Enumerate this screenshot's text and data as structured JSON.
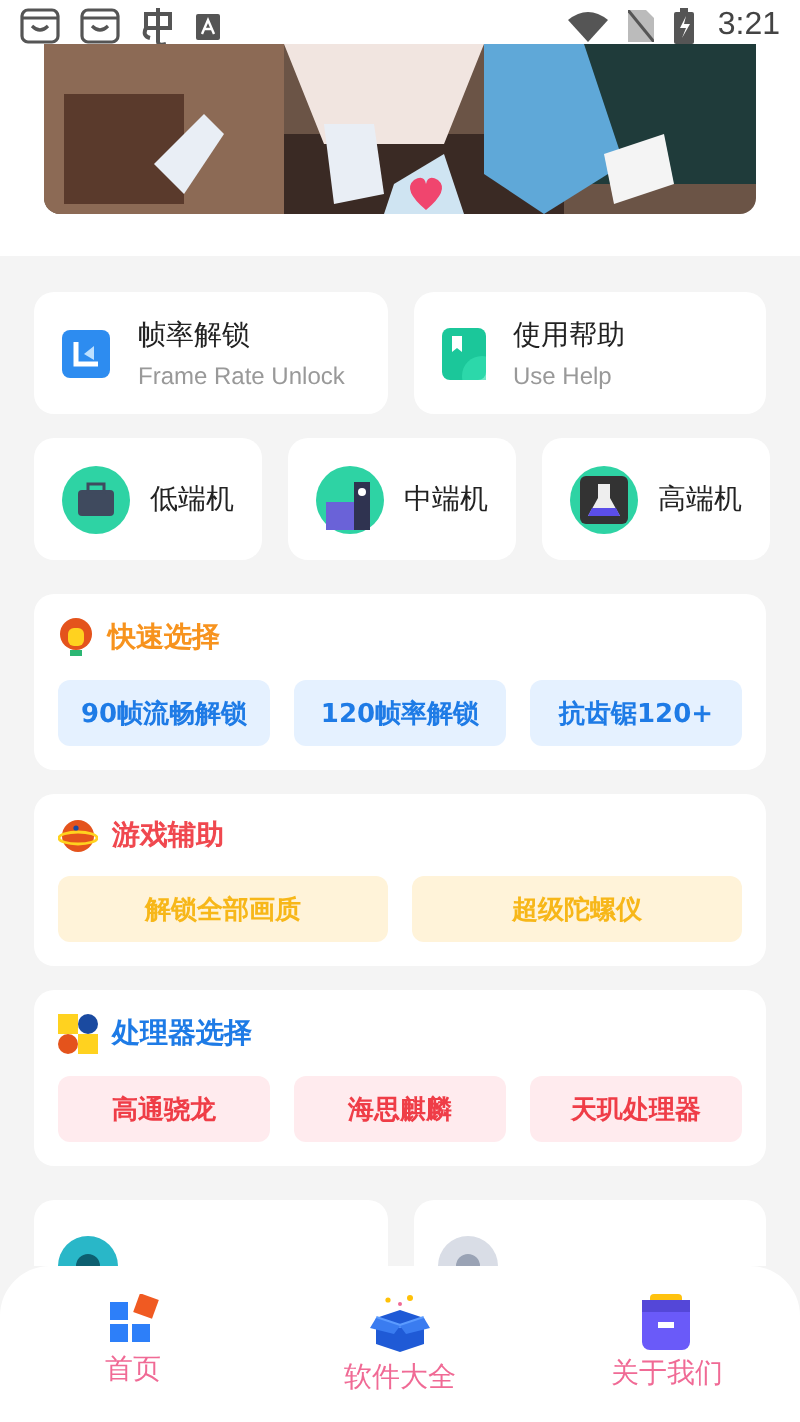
{
  "status_bar": {
    "time": "3:21"
  },
  "feature_cards": [
    {
      "title": "帧率解锁",
      "subtitle": "Frame Rate Unlock",
      "kind": "frame"
    },
    {
      "title": "使用帮助",
      "subtitle": "Use Help",
      "kind": "help"
    }
  ],
  "tiers": [
    {
      "label": "低端机",
      "kind": "low"
    },
    {
      "label": "中端机",
      "kind": "mid"
    },
    {
      "label": "高端机",
      "kind": "high"
    }
  ],
  "sections": [
    {
      "title": "快速选择",
      "kind": "quick",
      "options": [
        "90帧流畅解锁",
        "120帧率解锁",
        "抗齿锯120+"
      ]
    },
    {
      "title": "游戏辅助",
      "kind": "game",
      "options": [
        "解锁全部画质",
        "超级陀螺仪"
      ]
    },
    {
      "title": "处理器选择",
      "kind": "cpu",
      "options": [
        "高通骁龙",
        "海思麒麟",
        "天玑处理器"
      ]
    }
  ],
  "more_cards": [
    {
      "kind": "teal"
    },
    {
      "kind": "grey"
    }
  ],
  "nav": [
    {
      "label": "首页",
      "kind": "home"
    },
    {
      "label": "软件大全",
      "kind": "box"
    },
    {
      "label": "关于我们",
      "kind": "about"
    }
  ]
}
